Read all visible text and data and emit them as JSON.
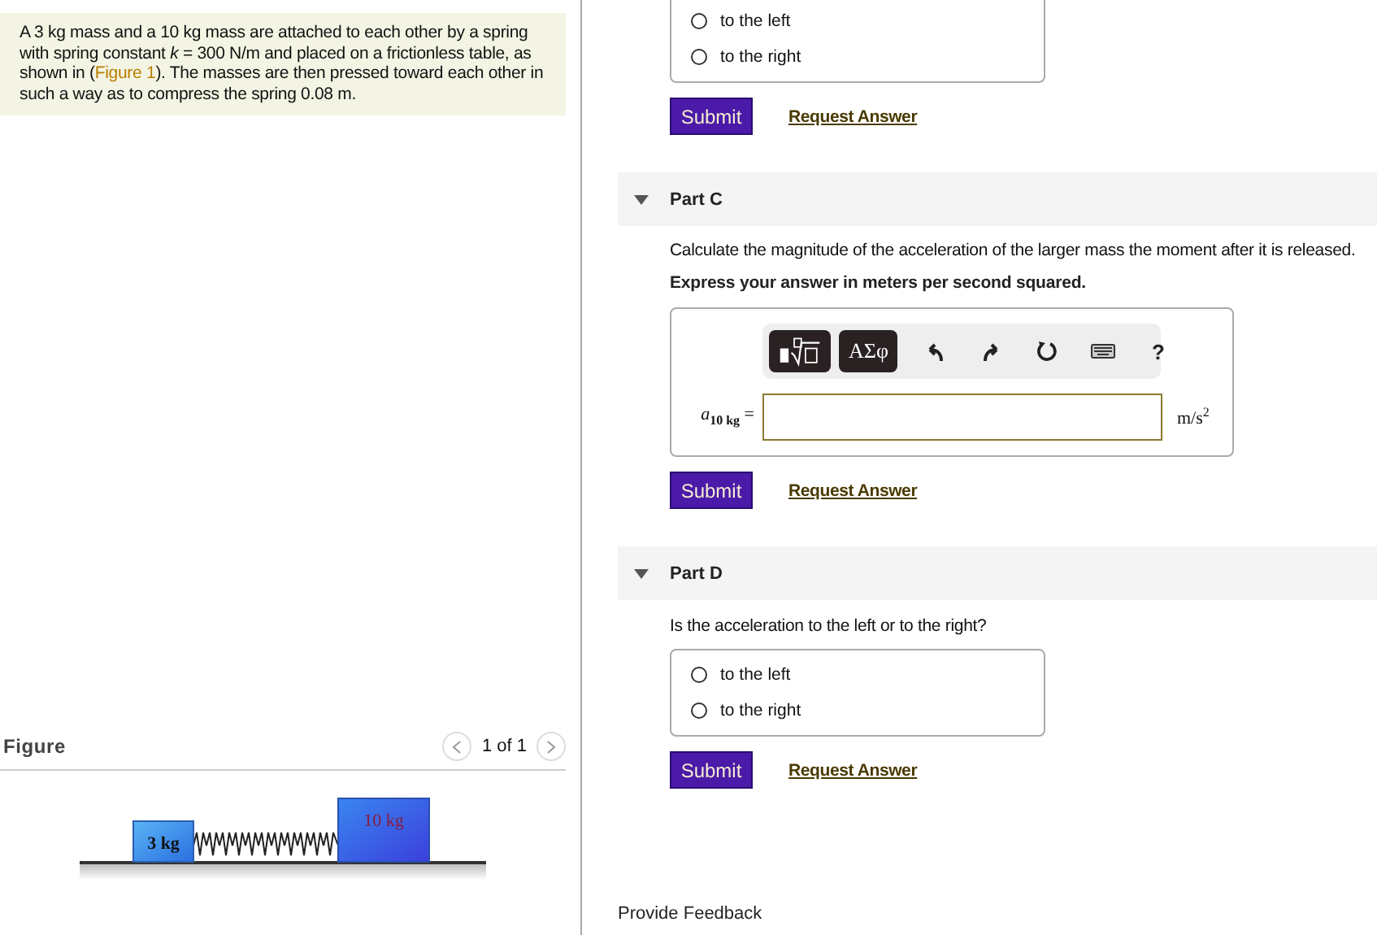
{
  "problem": {
    "text_before": "A 3 kg mass and a 10 kg mass are attached to each other by a spring with spring constant *k* = 300 N/m and placed on a frictionless table, as shown in (",
    "link": "Figure 1",
    "text_after": "). The masses are then pressed toward each other in such a way as to compress the spring 0.08 m."
  },
  "figure": {
    "title": "Figure",
    "pager": "1 of 1",
    "blocks": [
      {
        "label": "3 kg"
      },
      {
        "label": "10 kg"
      }
    ]
  },
  "parts": [
    {
      "kind": "choice",
      "options": [
        {
          "label": "to the left",
          "selected": false
        },
        {
          "label": "to the right",
          "selected": false
        }
      ],
      "submit": "Submit",
      "request": "Request Answer"
    },
    {
      "kind": "numeric",
      "title": "Part C",
      "expanded": true,
      "prompt": "Calculate the magnitude of the acceleration of the larger mass the moment after it is released.",
      "instruction": "Express your answer in meters per second squared.",
      "greek": "ΑΣφ",
      "help": "?",
      "variable": "*a*$_{10 kg}$ =",
      "units": "m/s$^{2}$",
      "submit": "Submit",
      "request": "Request Answer"
    },
    {
      "kind": "choice",
      "title": "Part D",
      "expanded": true,
      "prompt": "Is the acceleration to the left or to the right?",
      "options": [
        {
          "label": "to the left",
          "selected": false
        },
        {
          "label": "to the right",
          "selected": false
        }
      ],
      "submit": "Submit",
      "request": "Request Answer"
    }
  ],
  "feedback": "Provide Feedback"
}
